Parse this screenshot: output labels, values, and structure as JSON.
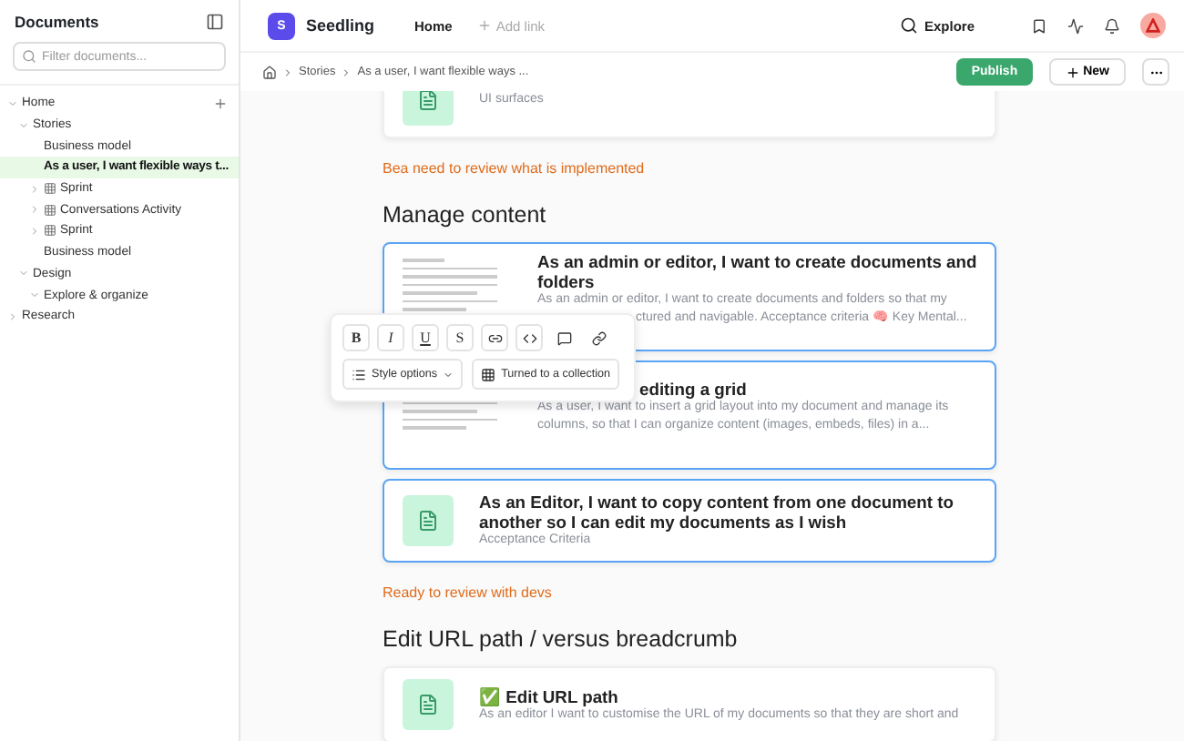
{
  "sidebar": {
    "title": "Documents",
    "search": {
      "placeholder": "Filter documents..."
    },
    "tree": [
      {
        "label": "Home",
        "collection": false,
        "expanded": true,
        "selected": false,
        "children": [
          {
            "label": "Stories",
            "collection": false,
            "expanded": true,
            "selected": false,
            "children": [
              {
                "label": "Business model",
                "collection": false,
                "selected": false
              },
              {
                "label": "As a user, I want flexible ways t...",
                "collection": false,
                "selected": true
              },
              {
                "label": "Sprint",
                "collection": true,
                "expanded": false,
                "selected": false
              },
              {
                "label": "Conversations Activity",
                "collection": true,
                "expanded": false,
                "selected": false
              },
              {
                "label": "Sprint",
                "collection": true,
                "expanded": false,
                "selected": false
              },
              {
                "label": "Business model",
                "collection": false,
                "selected": false
              }
            ]
          },
          {
            "label": "Design",
            "collection": false,
            "expanded": true,
            "selected": false,
            "children": [
              {
                "label": "Explore & organize",
                "collection": false,
                "expanded": true,
                "selected": false
              }
            ]
          }
        ]
      },
      {
        "label": "Research",
        "collection": false,
        "expanded": false,
        "selected": false
      }
    ]
  },
  "topbar": {
    "logo": "S",
    "workspace": "Seedling",
    "links": [
      {
        "label": "Home",
        "kind": "link"
      },
      {
        "label": "Add link",
        "kind": "add"
      }
    ],
    "explore": "Explore"
  },
  "breadcrumb": [
    "Stories",
    "As a user, I want flexible ways ..."
  ],
  "actions": {
    "publish": "Publish",
    "new": "New"
  },
  "content": [
    {
      "kind": "doc_card",
      "lines": [
        {
          "kind": "text",
          "text": "UI surfaces"
        }
      ],
      "focused": false
    },
    {
      "kind": "note",
      "text": "Bea need to review what is implemented"
    },
    {
      "kind": "heading",
      "text": "Manage content"
    },
    {
      "kind": "thumbnail_card",
      "title": {
        "kind": "text",
        "text": "As an admin or editor, I want to create documents and folders"
      },
      "lines": [
        {
          "kind": "text",
          "text": "As an admin or editor, I want to create documents and folders so that my"
        },
        {
          "kind": "beside_toolbar",
          "text": "ctured and navigable. Acceptance criteria 🧠 Key Mental..."
        }
      ],
      "focused": true
    },
    {
      "kind": "thumbnail_card",
      "title": {
        "kind": "beside_toolbar",
        "text": "editing a grid"
      },
      "lines": [
        {
          "kind": "text",
          "text": "As a user, I want to insert a grid layout into my document and manage its"
        },
        {
          "kind": "text",
          "text": "columns, so that I can organize content (images, embeds, files) in a..."
        }
      ],
      "focused": true
    },
    {
      "kind": "doc_card",
      "title": {
        "kind": "text",
        "text": "As an Editor, I want to copy content from one document to another so I can edit my documents as I wish"
      },
      "lines": [
        {
          "kind": "text",
          "text": "Acceptance Criteria"
        }
      ],
      "focused": true
    },
    {
      "kind": "note",
      "text": "Ready to review with devs"
    },
    {
      "kind": "heading",
      "text": "Edit URL path / versus breadcrumb"
    },
    {
      "kind": "doc_card",
      "title": {
        "kind": "text",
        "text": "✅ Edit URL path"
      },
      "lines": [
        {
          "kind": "text",
          "text": "As an editor I want to customise the URL of my documents so that they are short and"
        }
      ],
      "focused": false
    }
  ],
  "format_toolbar": {
    "marks": [
      {
        "kind": "text",
        "label": "B"
      },
      {
        "kind": "text",
        "label": "I"
      },
      {
        "kind": "text",
        "label": "U"
      },
      {
        "kind": "text",
        "label": "S"
      },
      {
        "kind": "chain"
      },
      {
        "kind": "code"
      },
      {
        "kind": "comment"
      },
      {
        "kind": "link"
      }
    ],
    "style_options": "Style options",
    "collection": "Turned to a collection"
  }
}
